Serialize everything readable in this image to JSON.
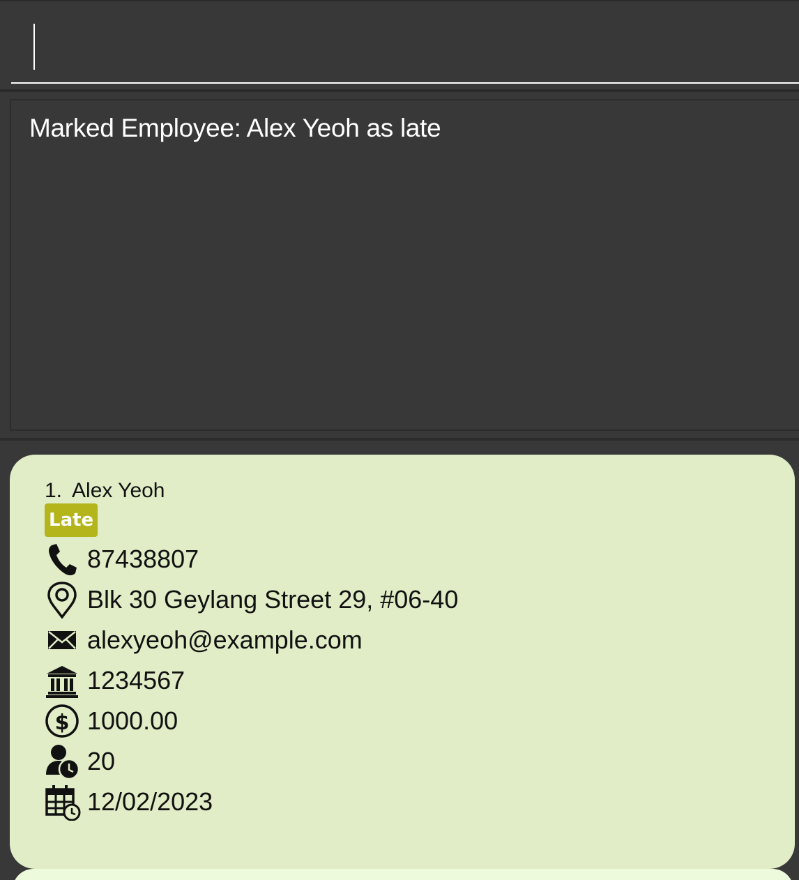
{
  "command_box": {
    "value": ""
  },
  "result_display": {
    "message": "Marked Employee: Alex Yeoh as late"
  },
  "person_list": {
    "cards": [
      {
        "index": "1.",
        "name": "Alex Yeoh",
        "tag": "Late",
        "tag_color": "#b3b51b",
        "card_color": "#e0edc6",
        "phone": "87438807",
        "address": "Blk 30 Geylang Street 29, #06-40",
        "email": "alexyeoh@example.com",
        "bank_account": "1234567",
        "salary": "1000.00",
        "leaves": "20",
        "join_date": "12/02/2023",
        "icons": [
          "phone-icon",
          "location-pin-icon",
          "envelope-icon",
          "bank-icon",
          "dollar-icon",
          "user-clock-icon",
          "calendar-clock-icon"
        ]
      }
    ]
  },
  "colors": {
    "background": "#383838",
    "text": "#ffffff"
  }
}
